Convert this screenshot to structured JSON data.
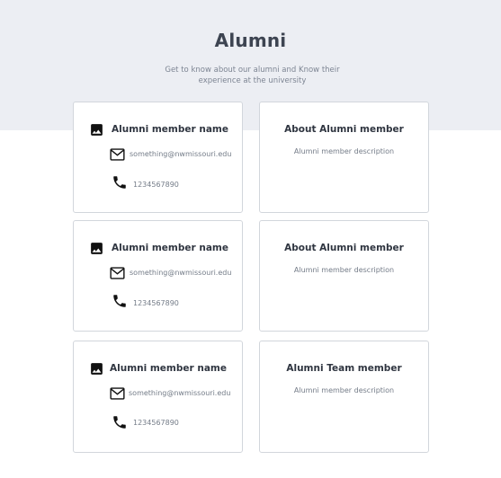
{
  "header": {
    "title": "Alumni",
    "subtitle": "Get to know about our alumni and Know their experience at the university"
  },
  "members": [
    {
      "name": "Alumni member name",
      "email": "something@nwmissouri.edu",
      "phone": "1234567890",
      "about_title": "About Alumni member",
      "about_description": "Alumni member description"
    },
    {
      "name": "Alumni member name",
      "email": "something@nwmissouri.edu",
      "phone": "1234567890",
      "about_title": "About Alumni member",
      "about_description": "Alumni member description"
    },
    {
      "name": "Alumni member name",
      "email": "something@nwmissouri.edu",
      "phone": "1234567890",
      "about_title": "Alumni Team member",
      "about_description": "Alumni member description"
    }
  ],
  "icons": {
    "photo": "image-icon",
    "email": "mail-icon",
    "phone": "phone-icon"
  },
  "colors": {
    "hero_background": "#eceef3",
    "card_border": "#d2d6dc",
    "title_text": "#3d4451",
    "muted_text": "#747c88"
  }
}
